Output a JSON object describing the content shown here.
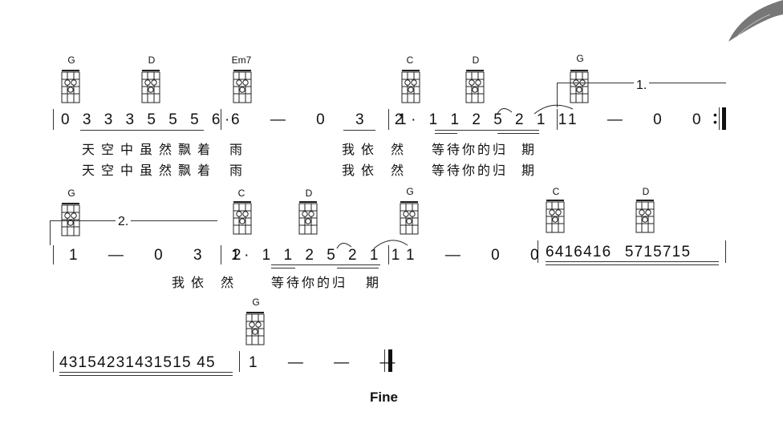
{
  "score": {
    "line1": {
      "chords": [
        "G",
        "D",
        "Em7",
        "C",
        "D",
        "G"
      ],
      "notes": [
        "0 3 3 3 5 5 5 6·",
        "6 — 0 3 2",
        "1· 1 1 2 5 2 1 1",
        "1 — 0 0"
      ],
      "lyrics_a": [
        "天空中虽然飘着",
        "雨",
        "我依 然",
        "等待你的归",
        "期"
      ],
      "lyrics_b": [
        "天空中虽然飘着",
        "雨",
        "我依 然",
        "等待你的归",
        "期"
      ],
      "volta": "1."
    },
    "line2": {
      "chords": [
        "G",
        "C",
        "D",
        "G",
        "C",
        "D"
      ],
      "notes": [
        "1 — 0 3 2",
        "1· 1 1 2 5 2 1 1",
        "1 — 0 0",
        "6416416 5715715"
      ],
      "lyrics": [
        "我依 然",
        "等待你的归",
        "期"
      ],
      "volta": "2."
    },
    "line3": {
      "chords": [
        "G"
      ],
      "notes": [
        "43154231431515 45",
        "1 — — —"
      ]
    },
    "ending": "Fine"
  }
}
